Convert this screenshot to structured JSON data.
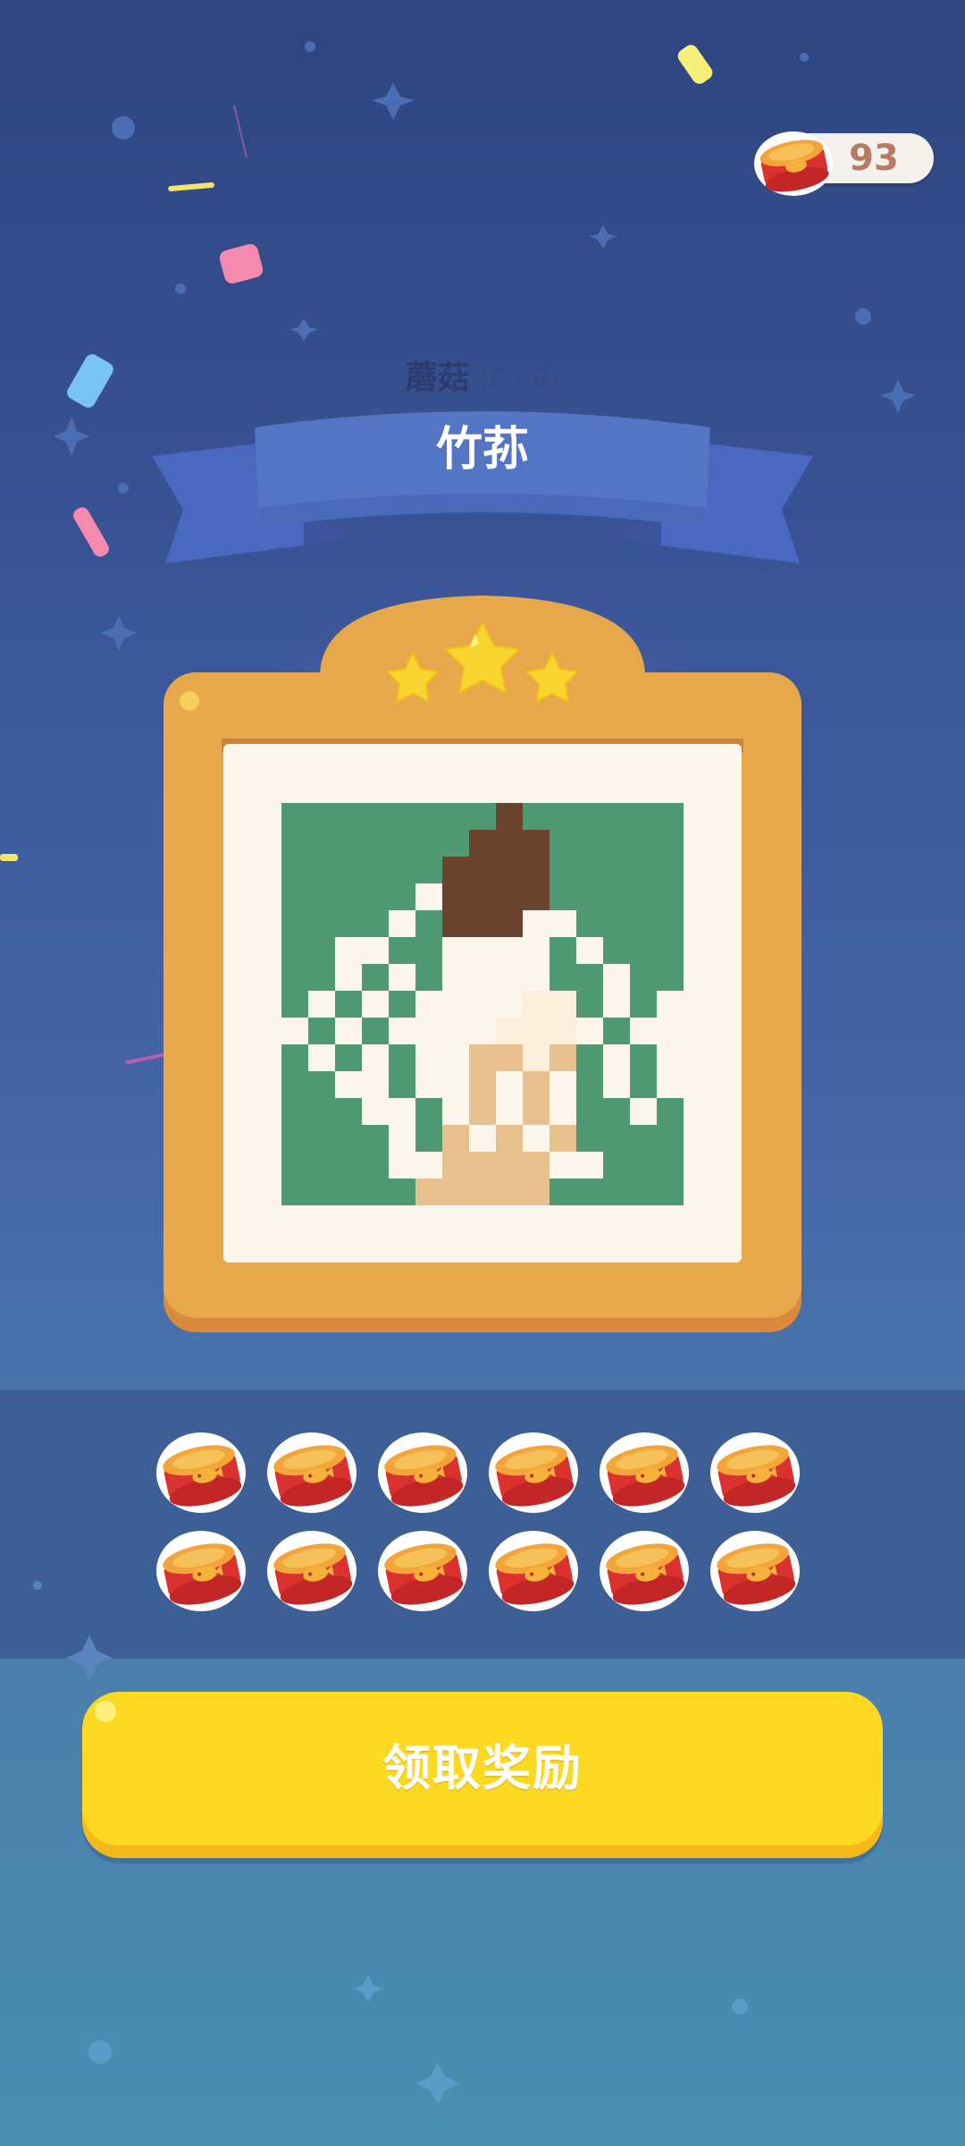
{
  "currency": {
    "icon": "cat-food-can-icon",
    "value": "93"
  },
  "puzzle": {
    "category": "蘑菇",
    "progress": "(8 / 8)",
    "title": "竹荪",
    "stars_earned": 3,
    "stars_total": 3
  },
  "rewards": {
    "icon": "cat-food-can-icon",
    "count": 12
  },
  "claim_button": {
    "label": "领取奖励"
  },
  "colors": {
    "accent_yellow": "#fdd922",
    "frame_orange": "#e6a84b",
    "ribbon_blue": "#5474c4",
    "pixel_green": "#4f9a72"
  }
}
